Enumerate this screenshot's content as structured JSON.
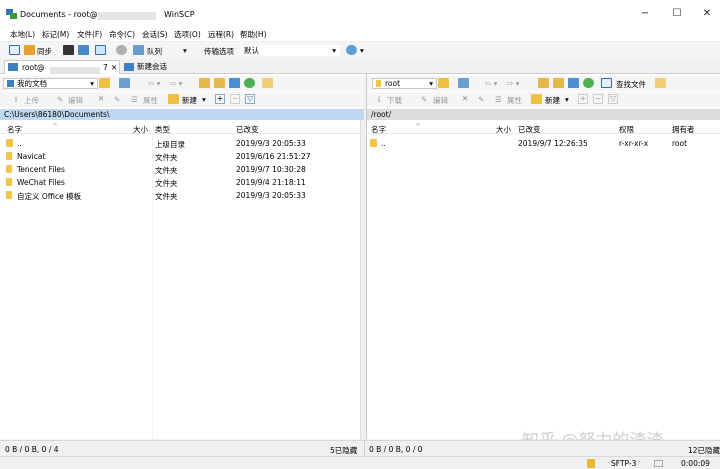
{
  "title_bar": {
    "text_prefix": "Documents - root@",
    "text_suffix": "WinSCP",
    "minimize": "−",
    "maximize": "☐",
    "close": "✕"
  },
  "menu": [
    "本地(L)",
    "标记(M)",
    "文件(F)",
    "命令(C)",
    "会话(S)",
    "选项(O)",
    "远程(R)",
    "帮助(H)"
  ],
  "toolbar": {
    "sync": "同步",
    "queue": "队列",
    "transfer_label": "传输选项",
    "transfer_value": "默认"
  },
  "tabs": {
    "session_prefix": "root@",
    "session_suffix": "7",
    "close": "✕",
    "new_session": "新建会话"
  },
  "left": {
    "location": "我的文档",
    "actions": {
      "upload": "上传",
      "edit": "编辑",
      "properties": "属性",
      "new": "新建"
    },
    "path": "C:\\Users\\86180\\Documents\\",
    "columns": {
      "name": "名字",
      "size": "大小",
      "type": "类型",
      "changed": "已改变"
    },
    "rows": [
      {
        "name": "..",
        "size": "",
        "type": "上级目录",
        "changed": "2019/9/3  20:05:33"
      },
      {
        "name": "Navicat",
        "size": "",
        "type": "文件夹",
        "changed": "2019/6/16  21:51:27"
      },
      {
        "name": "Tencent Files",
        "size": "",
        "type": "文件夹",
        "changed": "2019/9/7  10:30:28"
      },
      {
        "name": "WeChat Files",
        "size": "",
        "type": "文件夹",
        "changed": "2019/9/4  21:18:11"
      },
      {
        "name": "自定义 Office 模板",
        "size": "",
        "type": "文件夹",
        "changed": "2019/9/3  20:05:33"
      }
    ],
    "status": "0 B / 0 B,  0 / 4",
    "hidden": "5已隐藏"
  },
  "right": {
    "location": "root",
    "find_files": "查找文件",
    "actions": {
      "download": "下载",
      "edit": "编辑",
      "properties": "属性",
      "new": "新建"
    },
    "path": "/root/",
    "columns": {
      "name": "名字",
      "size": "大小",
      "changed": "已改变",
      "rights": "权限",
      "owner": "拥有者"
    },
    "rows": [
      {
        "name": "..",
        "size": "",
        "changed": "2019/9/7  12:26:35",
        "rights": "r-xr-xr-x",
        "owner": "root"
      }
    ],
    "status": "0 B / 0 B,  0 / 0",
    "hidden": "12已隐藏"
  },
  "bottom": {
    "protocol": "SFTP-3",
    "time": "0:00:09"
  },
  "watermark": "知乎 @努力的渣渣"
}
